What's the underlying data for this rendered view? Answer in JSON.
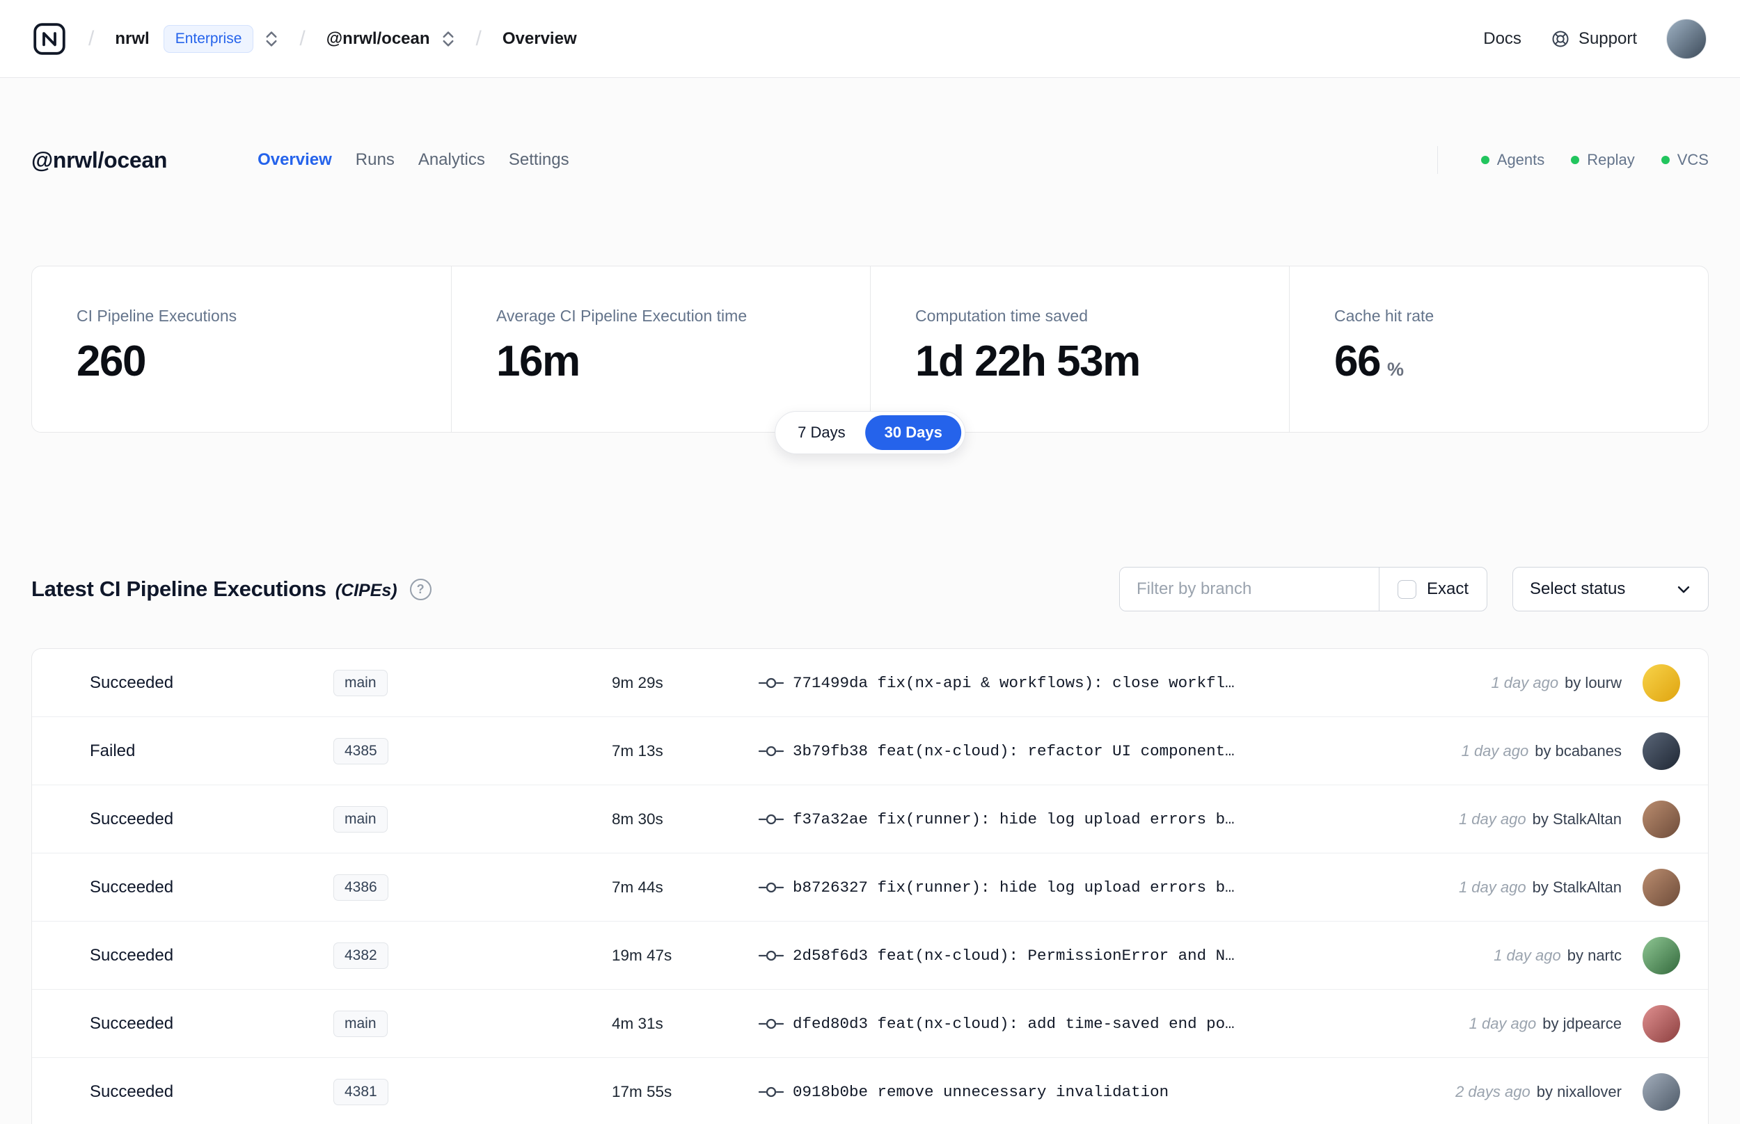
{
  "navbar": {
    "breadcrumb": {
      "org": "nrwl",
      "org_badge": "Enterprise",
      "workspace": "@nrwl/ocean",
      "page": "Overview"
    },
    "links": {
      "docs": "Docs",
      "support": "Support"
    }
  },
  "header": {
    "title": "@nrwl/ocean",
    "tabs": [
      {
        "label": "Overview",
        "active": true
      },
      {
        "label": "Runs",
        "active": false
      },
      {
        "label": "Analytics",
        "active": false
      },
      {
        "label": "Settings",
        "active": false
      }
    ],
    "indicators": [
      {
        "label": "Agents"
      },
      {
        "label": "Replay"
      },
      {
        "label": "VCS"
      }
    ]
  },
  "stats": [
    {
      "label": "CI Pipeline Executions",
      "value": "260"
    },
    {
      "label": "Average CI Pipeline Execution time",
      "value": "16m"
    },
    {
      "label": "Computation time saved",
      "value": "1d 22h 53m"
    },
    {
      "label": "Cache hit rate",
      "value": "66",
      "suffix": "%"
    }
  ],
  "range_toggle": {
    "options": [
      {
        "label": "7 Days",
        "active": false
      },
      {
        "label": "30 Days",
        "active": true
      }
    ]
  },
  "cipe_section": {
    "title": "Latest CI Pipeline Executions",
    "subtitle": "(CIPEs)",
    "help_glyph": "?",
    "filter_placeholder": "Filter by branch",
    "exact_label": "Exact",
    "status_select_label": "Select status"
  },
  "rows": [
    {
      "status": "Succeeded",
      "dot": "#22c55e",
      "branch": "main",
      "duration": "9m 29s",
      "commit": "771499da fix(nx-api & workflows): close workfl…",
      "time": "1 day ago",
      "author": "by lourw",
      "avatar": [
        "#f8d34a",
        "#dfa40f"
      ]
    },
    {
      "status": "Failed",
      "dot": "#ef4444",
      "branch": "4385",
      "duration": "7m 13s",
      "commit": "3b79fb38 feat(nx-cloud): refactor UI component…",
      "time": "1 day ago",
      "author": "by bcabanes",
      "avatar": [
        "#5a6678",
        "#1f2734"
      ]
    },
    {
      "status": "Succeeded",
      "dot": "#22c55e",
      "branch": "main",
      "duration": "8m 30s",
      "commit": "f37a32ae fix(runner): hide log upload errors b…",
      "time": "1 day ago",
      "author": "by StalkAltan",
      "avatar": [
        "#bb8d6f",
        "#6e4c3a"
      ]
    },
    {
      "status": "Succeeded",
      "dot": "#22c55e",
      "branch": "4386",
      "duration": "7m 44s",
      "commit": "b8726327 fix(runner): hide log upload errors b…",
      "time": "1 day ago",
      "author": "by StalkAltan",
      "avatar": [
        "#bb8d6f",
        "#6e4c3a"
      ]
    },
    {
      "status": "Succeeded",
      "dot": "#22c55e",
      "branch": "4382",
      "duration": "19m 47s",
      "commit": "2d58f6d3 feat(nx-cloud): PermissionError and N…",
      "time": "1 day ago",
      "author": "by nartc",
      "avatar": [
        "#8fc794",
        "#33693c"
      ]
    },
    {
      "status": "Succeeded",
      "dot": "#22c55e",
      "branch": "main",
      "duration": "4m 31s",
      "commit": "dfed80d3 feat(nx-cloud): add time-saved end po…",
      "time": "1 day ago",
      "author": "by jdpearce",
      "avatar": [
        "#e09090",
        "#8c3f3f"
      ]
    },
    {
      "status": "Succeeded",
      "dot": "#22c55e",
      "branch": "4381",
      "duration": "17m 55s",
      "commit": "0918b0be remove unnecessary invalidation",
      "time": "2 days ago",
      "author": "by nixallover",
      "avatar": [
        "#a3aebc",
        "#4e5a68"
      ]
    }
  ],
  "colors": {
    "accent": "#2563eb",
    "success": "#22c55e",
    "danger": "#ef4444"
  }
}
